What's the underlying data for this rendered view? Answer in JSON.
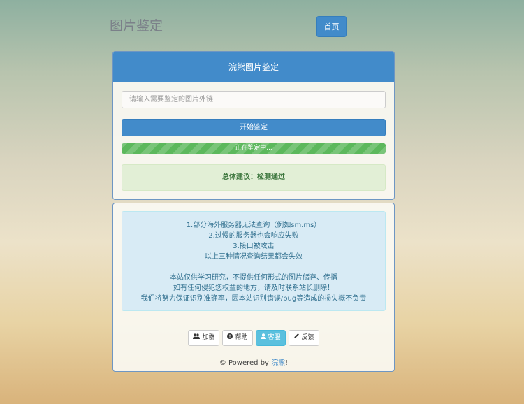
{
  "header": {
    "site_title": "图片鉴定",
    "home_label": "首页"
  },
  "check_panel": {
    "title": "浣熊图片鉴定",
    "input_placeholder": "请输入需要鉴定的图片外链",
    "start_label": "开始鉴定",
    "progress_label": "正在鉴定中...",
    "progress_value": 1.0,
    "result_text": "总体建议：检测通过"
  },
  "notice": {
    "lines_a": [
      "1.部分海外服务器无法查询（例如sm.ms）",
      "2.过慢的服务器也会响应失败",
      "3.接口被攻击",
      "以上三种情况查询结果都会失效"
    ],
    "lines_b": [
      "本站仅供学习研究，不提供任何形式的图片储存、传播",
      "如有任何侵犯您权益的地方，请及时联系站长删除！",
      "我们将努力保证识别准确率，因本站识别错误/bug等造成的损失概不负责"
    ]
  },
  "actions": {
    "join_label": "加群",
    "help_label": "帮助",
    "service_label": "客服",
    "feedback_label": "反馈"
  },
  "footer": {
    "prefix": "© Powered by ",
    "link": "浣熊",
    "suffix": "!"
  },
  "colors": {
    "primary": "#428bca",
    "success": "#5cb85c",
    "info": "#5bc0de"
  }
}
